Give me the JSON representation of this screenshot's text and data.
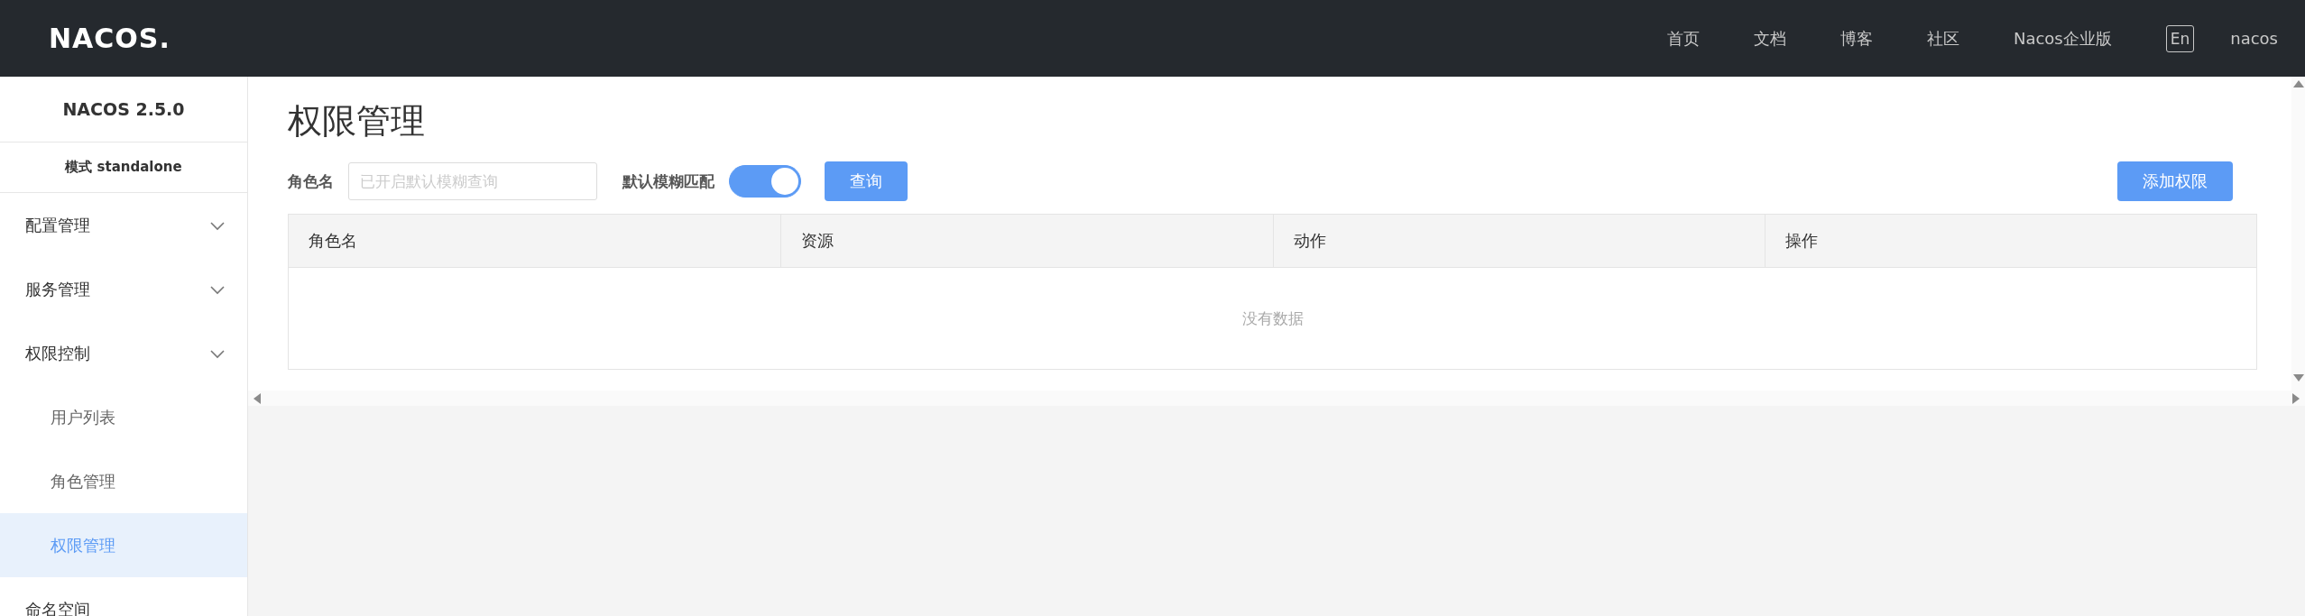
{
  "header": {
    "logo": "NACOS.",
    "nav": [
      {
        "label": "首页"
      },
      {
        "label": "文档"
      },
      {
        "label": "博客"
      },
      {
        "label": "社区"
      },
      {
        "label": "Nacos企业版"
      }
    ],
    "language": "En",
    "user": "nacos"
  },
  "sidebar": {
    "version": "NACOS 2.5.0",
    "mode": "模式 standalone",
    "items": [
      {
        "label": "配置管理",
        "kind": "group",
        "selected": false
      },
      {
        "label": "服务管理",
        "kind": "group",
        "selected": false
      },
      {
        "label": "权限控制",
        "kind": "group",
        "selected": false,
        "children": [
          {
            "label": "用户列表",
            "selected": false
          },
          {
            "label": "角色管理",
            "selected": false
          },
          {
            "label": "权限管理",
            "selected": true
          }
        ]
      },
      {
        "label": "命名空间",
        "kind": "link",
        "selected": false
      }
    ]
  },
  "page": {
    "title": "权限管理",
    "filter_label": "角色名",
    "filter_placeholder": "已开启默认模糊查询",
    "fuzzy_label": "默认模糊匹配",
    "fuzzy_on": true,
    "search_button": "查询",
    "add_button": "添加权限"
  },
  "table": {
    "columns": [
      "角色名",
      "资源",
      "动作",
      "操作"
    ],
    "empty_text": "没有数据"
  }
}
